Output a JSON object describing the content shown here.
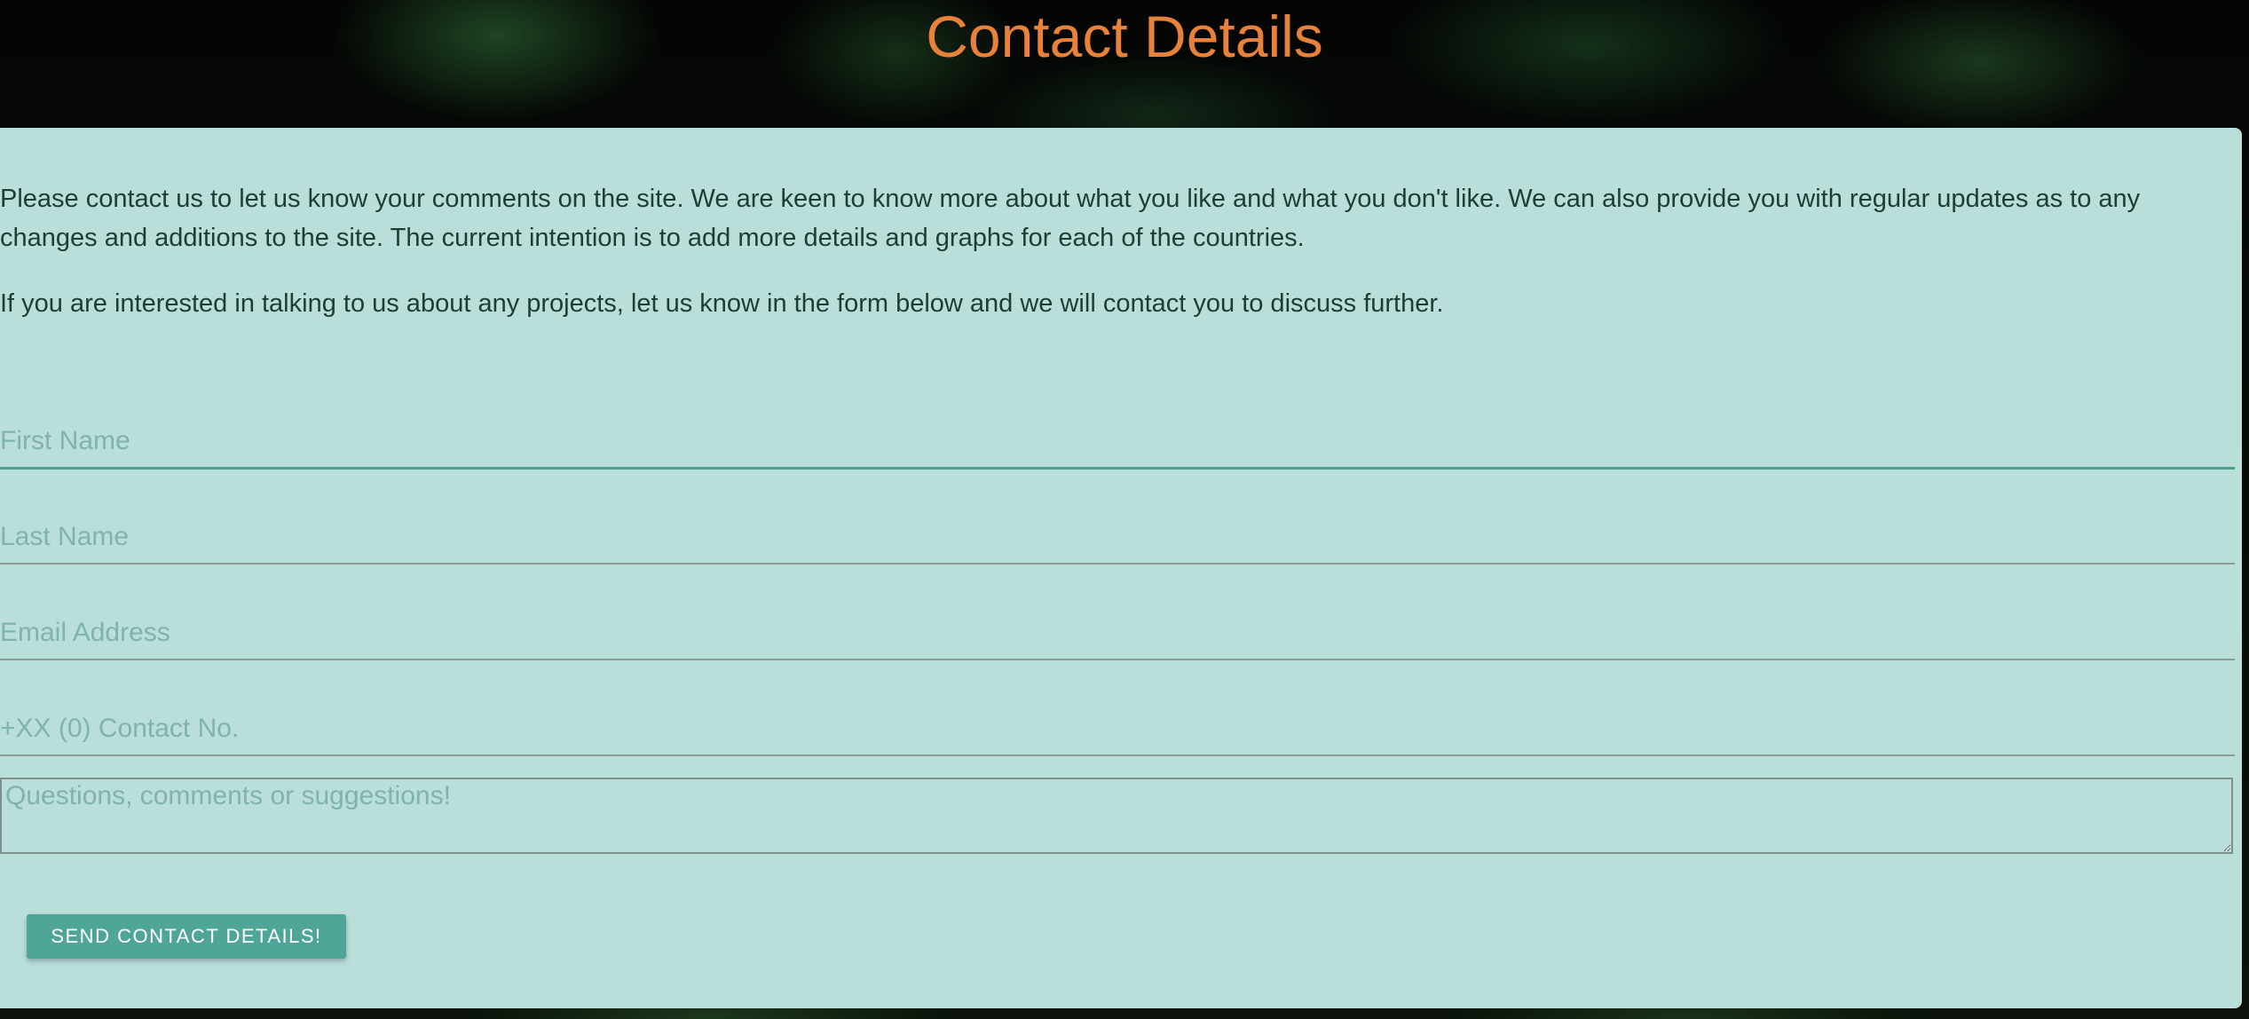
{
  "page": {
    "title": "Contact Details"
  },
  "intro": {
    "paragraph1": "Please contact us to let us know your comments on the site. We are keen to know more about what you like and what you don't like. We can also provide you with regular updates as to any changes and additions to the site. The current intention is to add more details and graphs for each of the countries.",
    "paragraph2": "If you are interested in talking to us about any projects, let us know in the form below and we will contact you to discuss further."
  },
  "form": {
    "first_name_placeholder": "First Name",
    "first_name_value": "",
    "last_name_placeholder": "Last Name",
    "last_name_value": "",
    "email_placeholder": "Email Address",
    "email_value": "",
    "phone_placeholder": "+XX (0) Contact No.",
    "phone_value": "",
    "message_placeholder": "Questions, comments or suggestions!",
    "message_value": "",
    "submit_label": "SEND CONTACT DETAILS!"
  },
  "colors": {
    "title": "#e8823a",
    "card_background": "#badfdb",
    "accent": "#4fa597",
    "placeholder": "#7fb3ab"
  }
}
